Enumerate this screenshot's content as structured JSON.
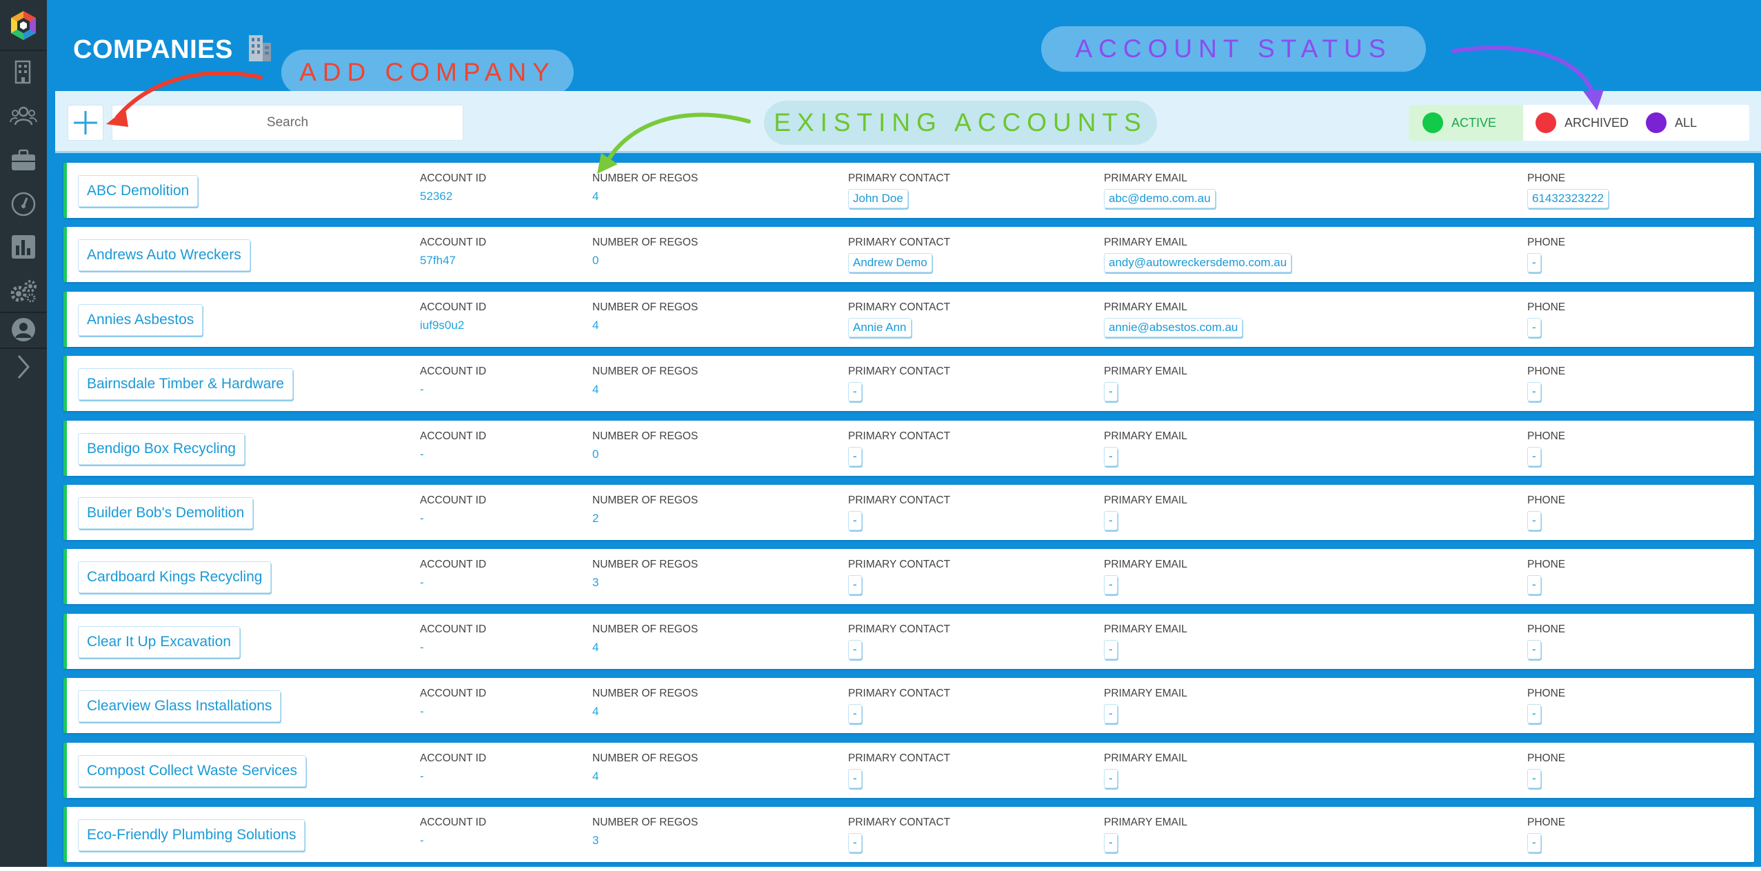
{
  "sidebar": {
    "icons": [
      "logo-icon",
      "building-icon",
      "users-icon",
      "briefcase-icon",
      "gauge-icon",
      "chart-icon",
      "gears-icon",
      "user-circle-icon",
      "chevron-right-icon"
    ]
  },
  "header": {
    "title": "COMPANIES",
    "title_emoji": "building-emoji",
    "add_company_callout": "ADD COMPANY",
    "account_status_callout": "ACCOUNT STATUS"
  },
  "toolbar": {
    "search_placeholder": "Search",
    "existing_accounts_callout": "EXISTING ACCOUNTS",
    "filters": [
      {
        "label": "ACTIVE",
        "color": "#12c94a",
        "selected": true
      },
      {
        "label": "ARCHIVED",
        "color": "#f0343c",
        "selected": false
      },
      {
        "label": "ALL",
        "color": "#7a22d4",
        "selected": false
      }
    ]
  },
  "columns": {
    "account_id": "ACCOUNT ID",
    "regos": "NUMBER OF REGOS",
    "contact": "PRIMARY CONTACT",
    "email": "PRIMARY EMAIL",
    "phone": "PHONE"
  },
  "companies": [
    {
      "name": "ABC Demolition",
      "account_id": "52362",
      "regos": "4",
      "contact": "John Doe",
      "email": "abc@demo.com.au",
      "phone": "61432323222"
    },
    {
      "name": "Andrews Auto Wreckers",
      "account_id": "57fh47",
      "regos": "0",
      "contact": "Andrew Demo",
      "email": "andy@autowreckersdemo.com.au",
      "phone": "-"
    },
    {
      "name": "Annies Asbestos",
      "account_id": "iuf9s0u2",
      "regos": "4",
      "contact": "Annie Ann",
      "email": "annie@absestos.com.au",
      "phone": "-"
    },
    {
      "name": "Bairnsdale Timber & Hardware",
      "account_id": "-",
      "regos": "4",
      "contact": "-",
      "email": "-",
      "phone": "-"
    },
    {
      "name": "Bendigo Box Recycling",
      "account_id": "-",
      "regos": "0",
      "contact": "-",
      "email": "-",
      "phone": "-"
    },
    {
      "name": "Builder Bob's Demolition",
      "account_id": "-",
      "regos": "2",
      "contact": "-",
      "email": "-",
      "phone": "-"
    },
    {
      "name": "Cardboard Kings Recycling",
      "account_id": "-",
      "regos": "3",
      "contact": "-",
      "email": "-",
      "phone": "-"
    },
    {
      "name": "Clear It Up Excavation",
      "account_id": "-",
      "regos": "4",
      "contact": "-",
      "email": "-",
      "phone": "-"
    },
    {
      "name": "Clearview Glass Installations",
      "account_id": "-",
      "regos": "4",
      "contact": "-",
      "email": "-",
      "phone": "-"
    },
    {
      "name": "Compost Collect Waste Services",
      "account_id": "-",
      "regos": "4",
      "contact": "-",
      "email": "-",
      "phone": "-"
    },
    {
      "name": "Eco-Friendly Plumbing Solutions",
      "account_id": "-",
      "regos": "3",
      "contact": "-",
      "email": "-",
      "phone": "-"
    }
  ]
}
